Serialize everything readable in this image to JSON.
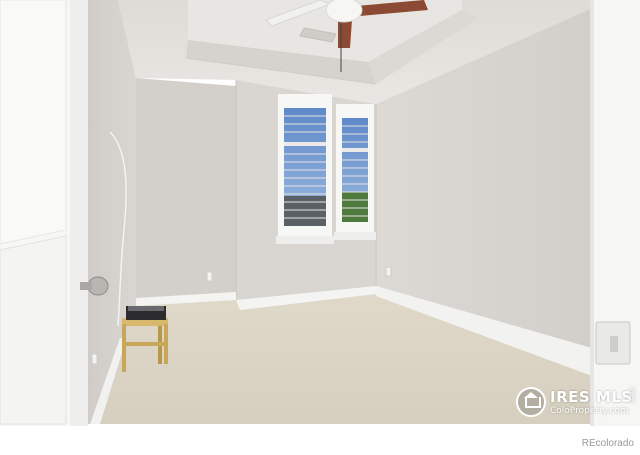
{
  "watermark": {
    "brand": "IRES MLS",
    "site": "ColoProperty.com",
    "side_text": "IRES"
  },
  "credit": "REcolorado",
  "colors": {
    "wall": "#d8d5d0",
    "ceiling": "#e6e3de",
    "carpet": "#ddd6c6",
    "trim": "#f6f6f4",
    "door": "#f7f7f6",
    "fan_blade": "#8a4a34"
  },
  "icons": {
    "watermark_logo": "house-in-circle-icon"
  }
}
